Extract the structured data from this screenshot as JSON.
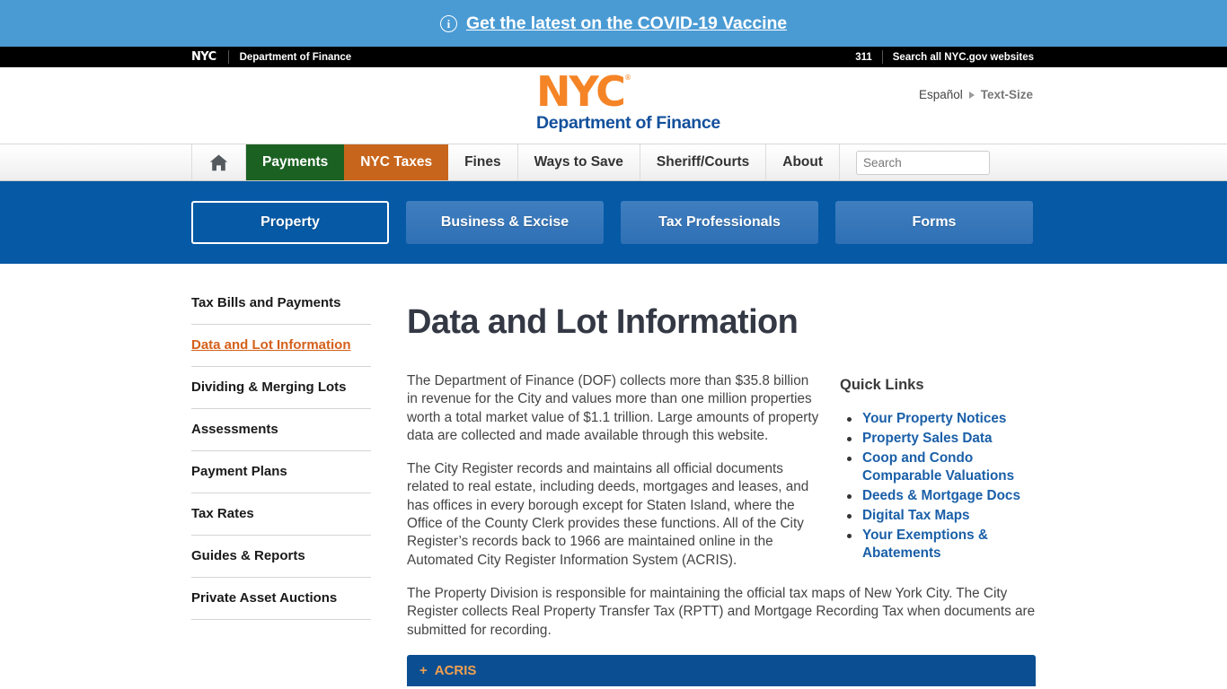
{
  "banner": {
    "icon": "info-circle-icon",
    "link_text": "Get the latest on the COVID-19 Vaccine"
  },
  "utility_bar": {
    "nyc_mark": "NYC",
    "agency": "Department of Finance",
    "phone_311": "311",
    "search_all": "Search all NYC.gov websites"
  },
  "logo": {
    "nyc": "NYC",
    "registered": "®",
    "department": "Department of Finance"
  },
  "language": {
    "espanol": "Español",
    "text_size": "Text-Size"
  },
  "mainnav": {
    "home_icon": "home-icon",
    "items": [
      {
        "label": "Payments",
        "state": "payments"
      },
      {
        "label": "NYC Taxes",
        "state": "taxes"
      },
      {
        "label": "Fines",
        "state": "plain"
      },
      {
        "label": "Ways to Save",
        "state": "plain"
      },
      {
        "label": "Sheriff/Courts",
        "state": "plain"
      },
      {
        "label": "About",
        "state": "plain"
      }
    ],
    "search_placeholder": "Search",
    "search_value": "",
    "search_icon": "magnifier-icon"
  },
  "subnav": {
    "buttons": [
      {
        "label": "Property",
        "active": true
      },
      {
        "label": "Business & Excise",
        "active": false
      },
      {
        "label": "Tax Professionals",
        "active": false
      },
      {
        "label": "Forms",
        "active": false
      }
    ]
  },
  "sidebar": {
    "items": [
      {
        "label": "Tax Bills and Payments",
        "active": false
      },
      {
        "label": "Data and Lot Information",
        "active": true
      },
      {
        "label": "Dividing & Merging Lots",
        "active": false
      },
      {
        "label": "Assessments",
        "active": false
      },
      {
        "label": "Payment Plans",
        "active": false
      },
      {
        "label": "Tax Rates",
        "active": false
      },
      {
        "label": "Guides & Reports",
        "active": false
      },
      {
        "label": "Private Asset Auctions",
        "active": false
      }
    ]
  },
  "main": {
    "title": "Data and Lot Information",
    "paragraphs": [
      "The Department of Finance (DOF) collects more than $35.8 billion in revenue for the City and values more than one million properties worth a total market value of $1.1 trillion. Large amounts of property data are collected and made available through this website.",
      "The City Register records and maintains all official documents related to real estate, including deeds, mortgages and leases, and has offices in every borough except for Staten Island, where the Office of the County Clerk provides these functions. All of the City Register’s records back to 1966 are maintained online in the Automated City Register Information System (ACRIS).",
      "The Property Division is responsible for maintaining the official tax maps of New York City. The City Register collects Real Property Transfer Tax (RPTT) and Mortgage Recording Tax when documents are submitted for recording."
    ],
    "accordion_label": "ACRIS",
    "accordion_icon": "plus-icon"
  },
  "quick_links": {
    "title": "Quick Links",
    "items": [
      "Your Property Notices",
      "Property Sales Data",
      "Coop and Condo Comparable Valuations",
      "Deeds & Mortgage Docs",
      "Digital Tax Maps",
      "Your Exemptions & Abatements"
    ]
  },
  "colors": {
    "banner_blue": "#4a9bd4",
    "subnav_blue": "#0559a5",
    "nyc_orange": "#f58426",
    "dept_blue": "#13509c",
    "payments_green": "#1b6122",
    "taxes_orange": "#c8651c",
    "link_blue": "#1a5fa8",
    "active_orange": "#d4601a"
  }
}
